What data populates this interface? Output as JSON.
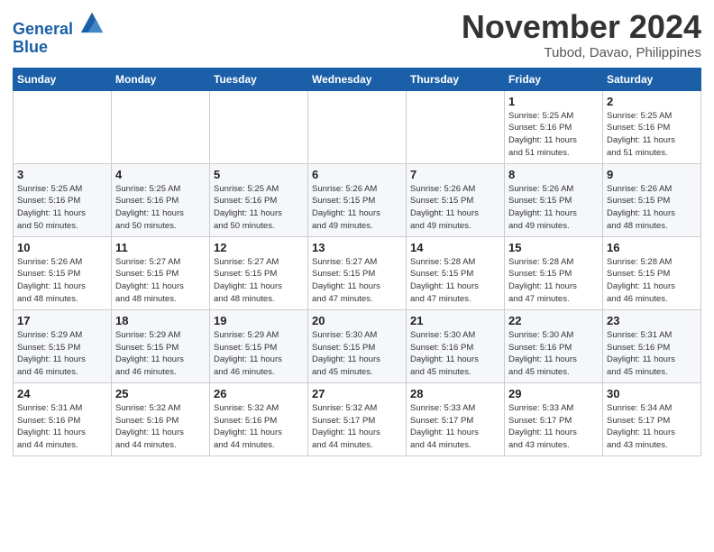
{
  "logo": {
    "line1": "General",
    "line2": "Blue"
  },
  "title": "November 2024",
  "location": "Tubod, Davao, Philippines",
  "days_of_week": [
    "Sunday",
    "Monday",
    "Tuesday",
    "Wednesday",
    "Thursday",
    "Friday",
    "Saturday"
  ],
  "weeks": [
    [
      {
        "day": "",
        "info": ""
      },
      {
        "day": "",
        "info": ""
      },
      {
        "day": "",
        "info": ""
      },
      {
        "day": "",
        "info": ""
      },
      {
        "day": "",
        "info": ""
      },
      {
        "day": "1",
        "info": "Sunrise: 5:25 AM\nSunset: 5:16 PM\nDaylight: 11 hours\nand 51 minutes."
      },
      {
        "day": "2",
        "info": "Sunrise: 5:25 AM\nSunset: 5:16 PM\nDaylight: 11 hours\nand 51 minutes."
      }
    ],
    [
      {
        "day": "3",
        "info": "Sunrise: 5:25 AM\nSunset: 5:16 PM\nDaylight: 11 hours\nand 50 minutes."
      },
      {
        "day": "4",
        "info": "Sunrise: 5:25 AM\nSunset: 5:16 PM\nDaylight: 11 hours\nand 50 minutes."
      },
      {
        "day": "5",
        "info": "Sunrise: 5:25 AM\nSunset: 5:16 PM\nDaylight: 11 hours\nand 50 minutes."
      },
      {
        "day": "6",
        "info": "Sunrise: 5:26 AM\nSunset: 5:15 PM\nDaylight: 11 hours\nand 49 minutes."
      },
      {
        "day": "7",
        "info": "Sunrise: 5:26 AM\nSunset: 5:15 PM\nDaylight: 11 hours\nand 49 minutes."
      },
      {
        "day": "8",
        "info": "Sunrise: 5:26 AM\nSunset: 5:15 PM\nDaylight: 11 hours\nand 49 minutes."
      },
      {
        "day": "9",
        "info": "Sunrise: 5:26 AM\nSunset: 5:15 PM\nDaylight: 11 hours\nand 48 minutes."
      }
    ],
    [
      {
        "day": "10",
        "info": "Sunrise: 5:26 AM\nSunset: 5:15 PM\nDaylight: 11 hours\nand 48 minutes."
      },
      {
        "day": "11",
        "info": "Sunrise: 5:27 AM\nSunset: 5:15 PM\nDaylight: 11 hours\nand 48 minutes."
      },
      {
        "day": "12",
        "info": "Sunrise: 5:27 AM\nSunset: 5:15 PM\nDaylight: 11 hours\nand 48 minutes."
      },
      {
        "day": "13",
        "info": "Sunrise: 5:27 AM\nSunset: 5:15 PM\nDaylight: 11 hours\nand 47 minutes."
      },
      {
        "day": "14",
        "info": "Sunrise: 5:28 AM\nSunset: 5:15 PM\nDaylight: 11 hours\nand 47 minutes."
      },
      {
        "day": "15",
        "info": "Sunrise: 5:28 AM\nSunset: 5:15 PM\nDaylight: 11 hours\nand 47 minutes."
      },
      {
        "day": "16",
        "info": "Sunrise: 5:28 AM\nSunset: 5:15 PM\nDaylight: 11 hours\nand 46 minutes."
      }
    ],
    [
      {
        "day": "17",
        "info": "Sunrise: 5:29 AM\nSunset: 5:15 PM\nDaylight: 11 hours\nand 46 minutes."
      },
      {
        "day": "18",
        "info": "Sunrise: 5:29 AM\nSunset: 5:15 PM\nDaylight: 11 hours\nand 46 minutes."
      },
      {
        "day": "19",
        "info": "Sunrise: 5:29 AM\nSunset: 5:15 PM\nDaylight: 11 hours\nand 46 minutes."
      },
      {
        "day": "20",
        "info": "Sunrise: 5:30 AM\nSunset: 5:15 PM\nDaylight: 11 hours\nand 45 minutes."
      },
      {
        "day": "21",
        "info": "Sunrise: 5:30 AM\nSunset: 5:16 PM\nDaylight: 11 hours\nand 45 minutes."
      },
      {
        "day": "22",
        "info": "Sunrise: 5:30 AM\nSunset: 5:16 PM\nDaylight: 11 hours\nand 45 minutes."
      },
      {
        "day": "23",
        "info": "Sunrise: 5:31 AM\nSunset: 5:16 PM\nDaylight: 11 hours\nand 45 minutes."
      }
    ],
    [
      {
        "day": "24",
        "info": "Sunrise: 5:31 AM\nSunset: 5:16 PM\nDaylight: 11 hours\nand 44 minutes."
      },
      {
        "day": "25",
        "info": "Sunrise: 5:32 AM\nSunset: 5:16 PM\nDaylight: 11 hours\nand 44 minutes."
      },
      {
        "day": "26",
        "info": "Sunrise: 5:32 AM\nSunset: 5:16 PM\nDaylight: 11 hours\nand 44 minutes."
      },
      {
        "day": "27",
        "info": "Sunrise: 5:32 AM\nSunset: 5:17 PM\nDaylight: 11 hours\nand 44 minutes."
      },
      {
        "day": "28",
        "info": "Sunrise: 5:33 AM\nSunset: 5:17 PM\nDaylight: 11 hours\nand 44 minutes."
      },
      {
        "day": "29",
        "info": "Sunrise: 5:33 AM\nSunset: 5:17 PM\nDaylight: 11 hours\nand 43 minutes."
      },
      {
        "day": "30",
        "info": "Sunrise: 5:34 AM\nSunset: 5:17 PM\nDaylight: 11 hours\nand 43 minutes."
      }
    ]
  ]
}
